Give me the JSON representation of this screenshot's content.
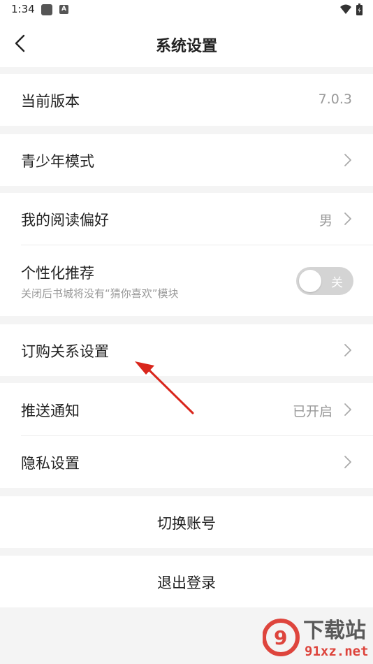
{
  "status_bar": {
    "time": "1:34"
  },
  "header": {
    "title": "系统设置"
  },
  "rows": {
    "version": {
      "label": "当前版本",
      "value": "7.0.3"
    },
    "youth_mode": {
      "label": "青少年模式"
    },
    "reading_pref": {
      "label": "我的阅读偏好",
      "value": "男"
    },
    "personalized": {
      "label": "个性化推荐",
      "subtitle": "关闭后书城将没有“猜你喜欢”模块",
      "toggle_text": "关"
    },
    "subscription": {
      "label": "订购关系设置"
    },
    "push": {
      "label": "推送通知",
      "value": "已开启"
    },
    "privacy": {
      "label": "隐私设置"
    },
    "switch_account": {
      "label": "切换账号"
    },
    "logout": {
      "label": "退出登录"
    }
  },
  "watermark": {
    "text_top": "下载站",
    "text_bottom": "91xz.net"
  },
  "colors": {
    "annotation_arrow": "#d9261c",
    "watermark_red": "#d9261c"
  }
}
